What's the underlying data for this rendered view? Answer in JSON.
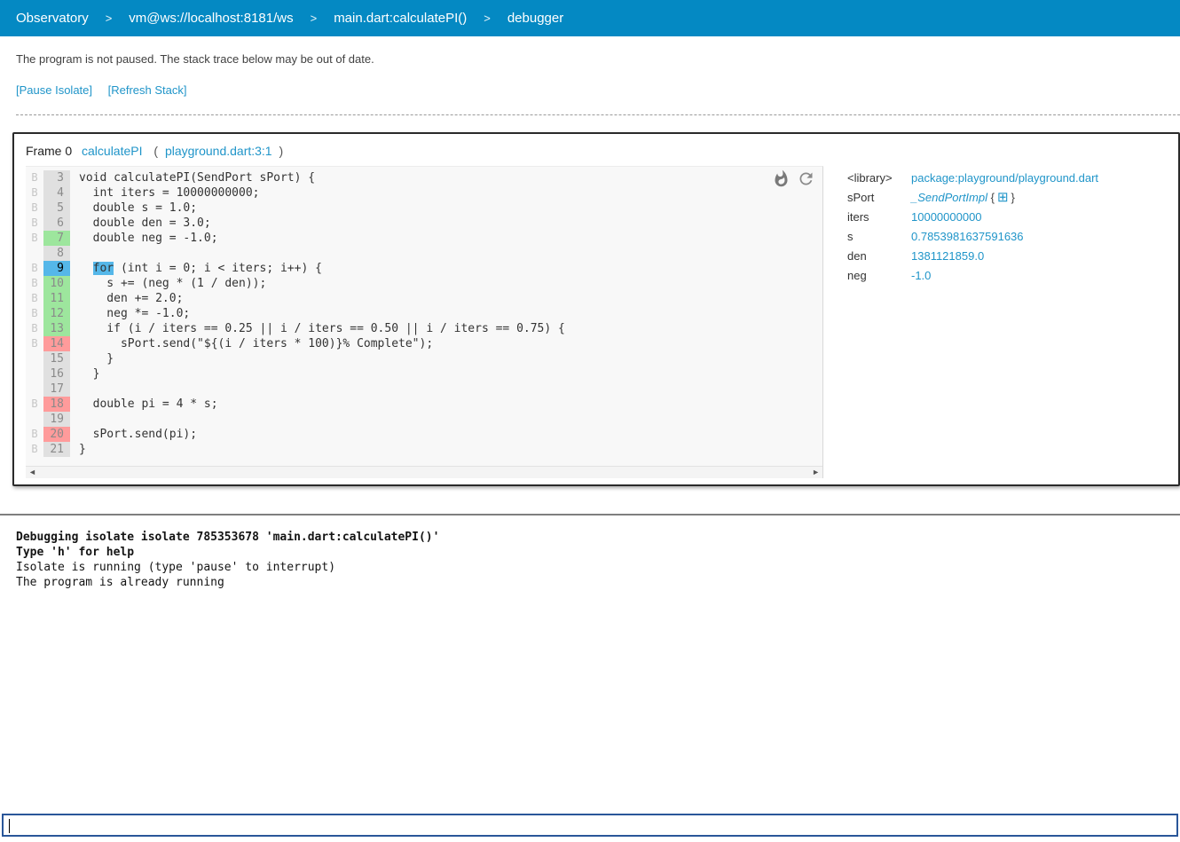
{
  "colors": {
    "navbar_blue": "#0489c3",
    "link_blue": "#2095c9",
    "gutter_default": "#e0e0e0",
    "gutter_green": "#9de69d",
    "gutter_current_blue": "#55b7e9",
    "gutter_red": "#ff9b9b",
    "input_border": "#2a5699"
  },
  "nav": {
    "separator": ">",
    "items": [
      {
        "label": "Observatory"
      },
      {
        "label": "vm@ws://localhost:8181/ws"
      },
      {
        "label": "main.dart:calculatePI()"
      },
      {
        "label": "debugger"
      }
    ]
  },
  "status": {
    "message": "The program is not paused. The stack trace below may be out of date.",
    "pause_label": "[Pause Isolate]",
    "refresh_label": "[Refresh Stack]"
  },
  "frame": {
    "label": "Frame 0",
    "function_link": "calculatePI",
    "open_paren": "(",
    "location_link": "playground.dart:3:1",
    "close_paren": ")"
  },
  "code": {
    "breakpoint_label": "B",
    "icons": {
      "coverage": "flame-icon",
      "reload": "refresh-icon"
    },
    "scrollbar": {
      "left_arrow": "◄",
      "right_arrow": "►"
    },
    "lines": [
      {
        "num": 3,
        "bp": true,
        "hl": "gray",
        "text": "void calculatePI(SendPort sPort) {"
      },
      {
        "num": 4,
        "bp": true,
        "hl": "gray",
        "text": "  int iters = 10000000000;"
      },
      {
        "num": 5,
        "bp": true,
        "hl": "gray",
        "text": "  double s = 1.0;"
      },
      {
        "num": 6,
        "bp": true,
        "hl": "gray",
        "text": "  double den = 3.0;"
      },
      {
        "num": 7,
        "bp": true,
        "hl": "green",
        "text": "  double neg = -1.0;"
      },
      {
        "num": 8,
        "bp": false,
        "hl": "gray",
        "text": ""
      },
      {
        "num": 9,
        "bp": true,
        "hl": "blue",
        "text": "  for (int i = 0; i < iters; i++) {",
        "hl_token": "for"
      },
      {
        "num": 10,
        "bp": true,
        "hl": "green",
        "text": "    s += (neg * (1 / den));"
      },
      {
        "num": 11,
        "bp": true,
        "hl": "green",
        "text": "    den += 2.0;"
      },
      {
        "num": 12,
        "bp": true,
        "hl": "green",
        "text": "    neg *= -1.0;"
      },
      {
        "num": 13,
        "bp": true,
        "hl": "green",
        "text": "    if (i / iters == 0.25 || i / iters == 0.50 || i / iters == 0.75) {"
      },
      {
        "num": 14,
        "bp": true,
        "hl": "red",
        "text": "      sPort.send(\"${(i / iters * 100)}% Complete\");"
      },
      {
        "num": 15,
        "bp": false,
        "hl": "gray",
        "text": "    }"
      },
      {
        "num": 16,
        "bp": false,
        "hl": "gray",
        "text": "  }"
      },
      {
        "num": 17,
        "bp": false,
        "hl": "gray",
        "text": ""
      },
      {
        "num": 18,
        "bp": true,
        "hl": "red",
        "text": "  double pi = 4 * s;"
      },
      {
        "num": 19,
        "bp": false,
        "hl": "gray",
        "text": ""
      },
      {
        "num": 20,
        "bp": true,
        "hl": "red",
        "text": "  sPort.send(pi);"
      },
      {
        "num": 21,
        "bp": true,
        "hl": "gray",
        "text": "}"
      }
    ]
  },
  "variables": {
    "rows": [
      {
        "name": "<library>",
        "value": "package:playground/playground.dart",
        "style": "link"
      },
      {
        "name": "sPort",
        "value": "_SendPortImpl",
        "style": "italic-link",
        "expander": {
          "open": "{",
          "icon": "grid-icon",
          "icon_glyph": "⊞",
          "close": "}"
        }
      },
      {
        "name": "iters",
        "value": "10000000000",
        "style": "link"
      },
      {
        "name": "s",
        "value": "0.7853981637591636",
        "style": "link"
      },
      {
        "name": "den",
        "value": "1381121859.0",
        "style": "link"
      },
      {
        "name": "neg",
        "value": "-1.0",
        "style": "link"
      }
    ]
  },
  "console": {
    "lines": [
      {
        "text": "Debugging isolate isolate 785353678 'main.dart:calculatePI()'",
        "bold": true
      },
      {
        "text": "Type 'h' for help",
        "bold": true
      },
      {
        "text": "Isolate is running (type 'pause' to interrupt)",
        "bold": false
      },
      {
        "text": "The program is already running",
        "bold": false
      }
    ]
  },
  "command_input": {
    "value": ""
  }
}
